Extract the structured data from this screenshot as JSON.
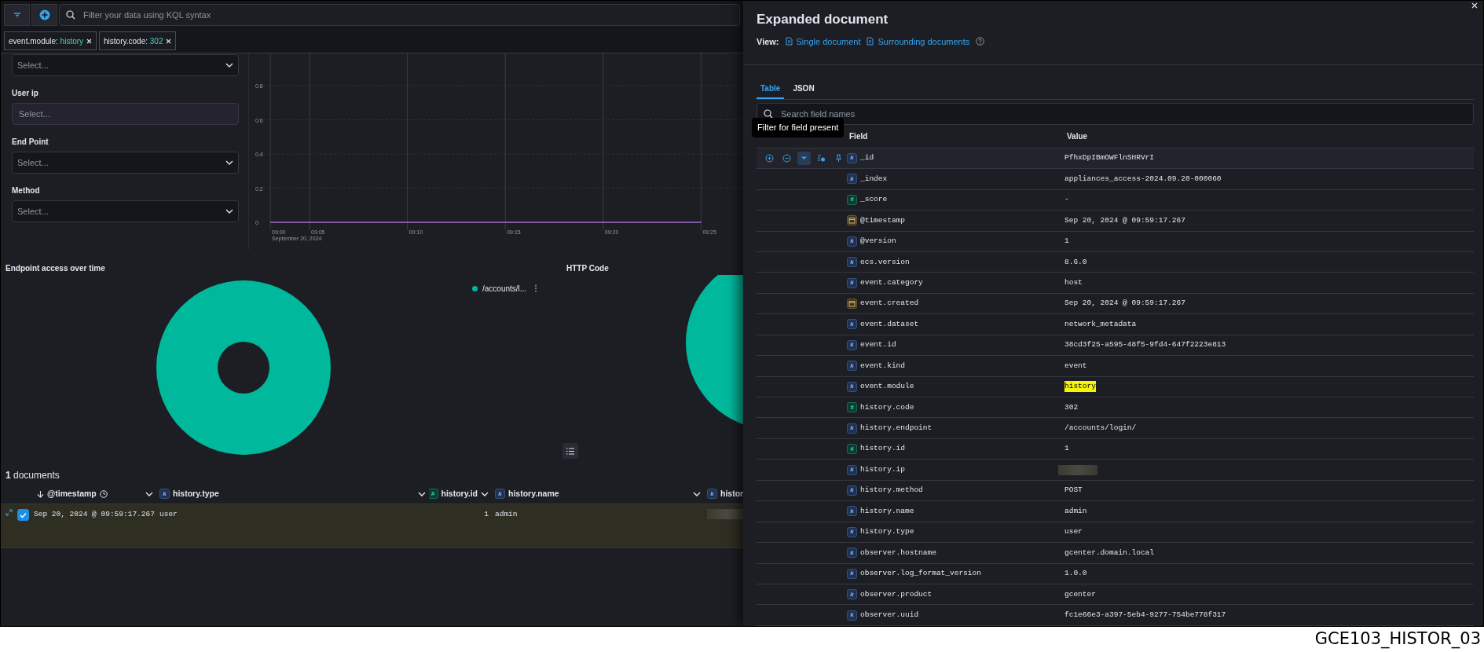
{
  "query_bar": {
    "placeholder": "Filter your data using KQL syntax"
  },
  "filters": [
    {
      "field": "event.module:",
      "value": "history"
    },
    {
      "field": "history.code:",
      "value": "302"
    }
  ],
  "controls": [
    {
      "kind": "select",
      "placeholder": "Select..."
    },
    {
      "kind": "input",
      "label": "User ip",
      "placeholder": "Select..."
    },
    {
      "kind": "select",
      "label": "End Point",
      "placeholder": "Select..."
    },
    {
      "kind": "select",
      "label": "Method",
      "placeholder": "Select..."
    }
  ],
  "timeline": {
    "chart_data": {
      "type": "line",
      "x": [
        "09:00",
        "09:05",
        "09:10",
        "09:15",
        "09:20",
        "09:25"
      ],
      "xlabel": "September 20, 2024",
      "yticks": [
        0,
        0.2,
        0.4,
        0.6,
        0.8
      ],
      "ylim": [
        0,
        1
      ],
      "grid": true,
      "series": [
        {
          "color": "#a36bd0",
          "values": [
            0,
            0,
            0,
            0,
            0,
            0
          ]
        }
      ]
    }
  },
  "panels": [
    {
      "title": "Endpoint access over time",
      "legend": [
        {
          "label": "/accounts/l...",
          "color": "#00b89c"
        }
      ]
    },
    {
      "title": "HTTP Code"
    }
  ],
  "documents": {
    "count_text": "**1** documents",
    "columns": [
      {
        "name": "@timestamp",
        "kind": "time",
        "sorted": true
      },
      {
        "name": "history.type",
        "kind": "keyword",
        "glyph": "k"
      },
      {
        "name": "history.id",
        "kind": "number",
        "glyph": "#"
      },
      {
        "name": "history.name",
        "kind": "keyword",
        "glyph": "k"
      },
      {
        "name": "histor",
        "kind": "keyword",
        "glyph": "k"
      }
    ],
    "rows": [
      {
        "expanded": true,
        "checked": true,
        "cells": [
          {
            "text": "Sep 20, 2024 @ 09:59:17.267"
          },
          {
            "text": "user"
          },
          {
            "text": "1"
          },
          {
            "text": "admin"
          },
          {
            "kind": "redacted"
          }
        ]
      }
    ]
  },
  "flyout": {
    "title": "Expanded document",
    "view_label": "View:",
    "views": [
      {
        "label": "Single document"
      },
      {
        "label": "Surrounding documents"
      }
    ],
    "tabs": [
      {
        "label": "Table",
        "selected": true
      },
      {
        "label": "JSON",
        "selected": false
      }
    ],
    "search": {
      "placeholder": "Search field names"
    },
    "tooltip": "Filter for field present",
    "columns": [
      "Field",
      "Value"
    ],
    "rows": [
      {
        "field": "_id",
        "kind": "keyword",
        "glyph": "k",
        "value": "PfhxDpIBmOWFlnSHRVrI",
        "actions": [
          {
            "kind": "filter-for",
            "hovered": false
          },
          {
            "kind": "filter-out",
            "hovered": false
          },
          {
            "kind": "filter-exists",
            "hovered": true
          },
          {
            "kind": "toggle-column",
            "hovered": false
          },
          {
            "kind": "pin",
            "hovered": false
          }
        ]
      },
      {
        "field": "_index",
        "kind": "keyword",
        "glyph": "k",
        "value": "appliances_access-2024.09.20-000060"
      },
      {
        "field": "_score",
        "kind": "number",
        "glyph": "#",
        "value": "-"
      },
      {
        "field": "@timestamp",
        "kind": "date",
        "value": "Sep 20, 2024 @ 09:59:17.267"
      },
      {
        "field": "@version",
        "kind": "keyword",
        "glyph": "k",
        "value": "1"
      },
      {
        "field": "ecs.version",
        "kind": "keyword",
        "glyph": "k",
        "value": "8.6.0"
      },
      {
        "field": "event.category",
        "kind": "keyword",
        "glyph": "k",
        "value": "host"
      },
      {
        "field": "event.created",
        "kind": "date",
        "value": "Sep 20, 2024 @ 09:59:17.267"
      },
      {
        "field": "event.dataset",
        "kind": "keyword",
        "glyph": "k",
        "value": "network_metadata"
      },
      {
        "field": "event.id",
        "kind": "keyword",
        "glyph": "k",
        "value": "38cd3f25-a595-48f5-9fd4-647f2223e813"
      },
      {
        "field": "event.kind",
        "kind": "keyword",
        "glyph": "k",
        "value": "event"
      },
      {
        "field": "event.module",
        "kind": "keyword",
        "glyph": "k",
        "value": "history",
        "highlighted": true
      },
      {
        "field": "history.code",
        "kind": "number",
        "glyph": "#",
        "value": "302"
      },
      {
        "field": "history.endpoint",
        "kind": "keyword",
        "glyph": "k",
        "value": "/accounts/login/"
      },
      {
        "field": "history.id",
        "kind": "number",
        "glyph": "#",
        "value": "1"
      },
      {
        "field": "history.ip",
        "kind": "keyword",
        "glyph": "k"
      },
      {
        "field": "history.method",
        "kind": "keyword",
        "glyph": "k",
        "value": "POST"
      },
      {
        "field": "history.name",
        "kind": "keyword",
        "glyph": "k",
        "value": "admin"
      },
      {
        "field": "history.type",
        "kind": "keyword",
        "glyph": "k",
        "value": "user"
      },
      {
        "field": "observer.hostname",
        "kind": "keyword",
        "glyph": "k",
        "value": "gcenter.domain.local"
      },
      {
        "field": "observer.log_format_version",
        "kind": "keyword",
        "glyph": "k",
        "value": "1.0.0"
      },
      {
        "field": "observer.product",
        "kind": "keyword",
        "glyph": "k",
        "value": "gcenter"
      },
      {
        "field": "observer.uuid",
        "kind": "keyword",
        "glyph": "k",
        "value": "fc1e66e3-a397-5eb4-9277-754be778f317"
      }
    ]
  },
  "caption": "GCE103_HISTOR_03"
}
